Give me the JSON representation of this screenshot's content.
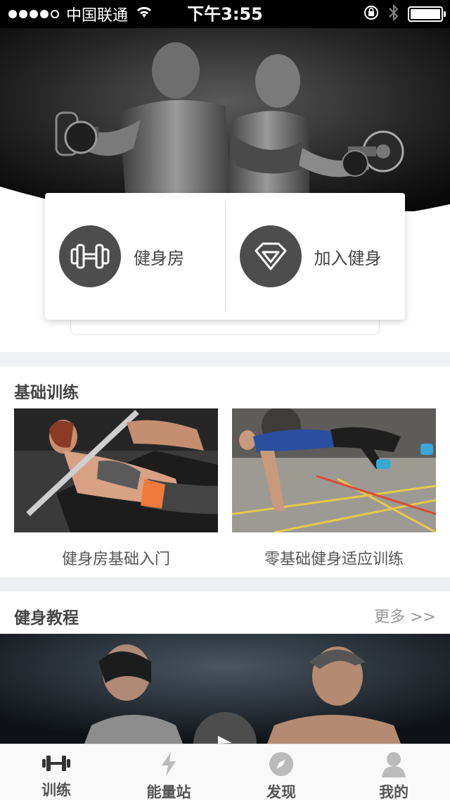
{
  "status_bar": {
    "carrier": "中国联通",
    "time": "下午3:55",
    "battery_level": 1.0
  },
  "hero": {
    "image": "fitness couple with dumbbells"
  },
  "quick_actions": [
    {
      "label": "健身房",
      "icon": "dumbbell-icon"
    },
    {
      "label": "加入健身",
      "icon": "diamond-icon"
    }
  ],
  "basic_training": {
    "title": "基础训练",
    "items": [
      {
        "caption": "健身房基础入门"
      },
      {
        "caption": "零基础健身适应训练"
      }
    ]
  },
  "tutorials": {
    "title": "健身教程",
    "more_label": "更多 >>"
  },
  "tab_bar": {
    "active_color": "#333333",
    "inactive_color": "#bbbbbb",
    "tabs": [
      {
        "label": "训练",
        "icon": "dumbbell-icon",
        "active": true
      },
      {
        "label": "能量站",
        "icon": "lightning-icon",
        "active": false
      },
      {
        "label": "发现",
        "icon": "compass-icon",
        "active": false
      },
      {
        "label": "我的",
        "icon": "user-icon",
        "active": false
      }
    ]
  }
}
